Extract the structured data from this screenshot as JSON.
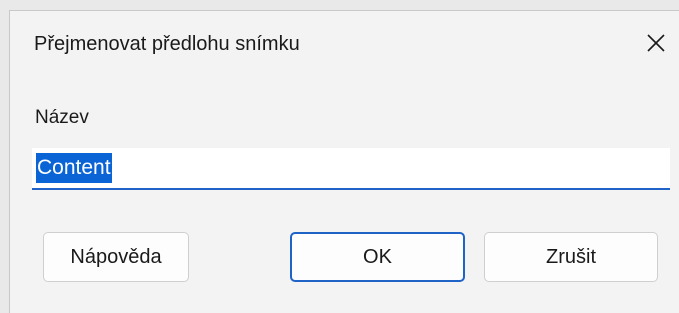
{
  "dialog": {
    "title": "Přejmenovat předlohu snímku",
    "close_icon": "close-icon",
    "field_label": "Název",
    "input_value": "Content",
    "buttons": {
      "help": "Nápověda",
      "ok": "OK",
      "cancel": "Zrušit"
    },
    "colors": {
      "accent": "#1f63c7",
      "selection": "#0a64d6",
      "background": "#f3f3f3"
    }
  }
}
